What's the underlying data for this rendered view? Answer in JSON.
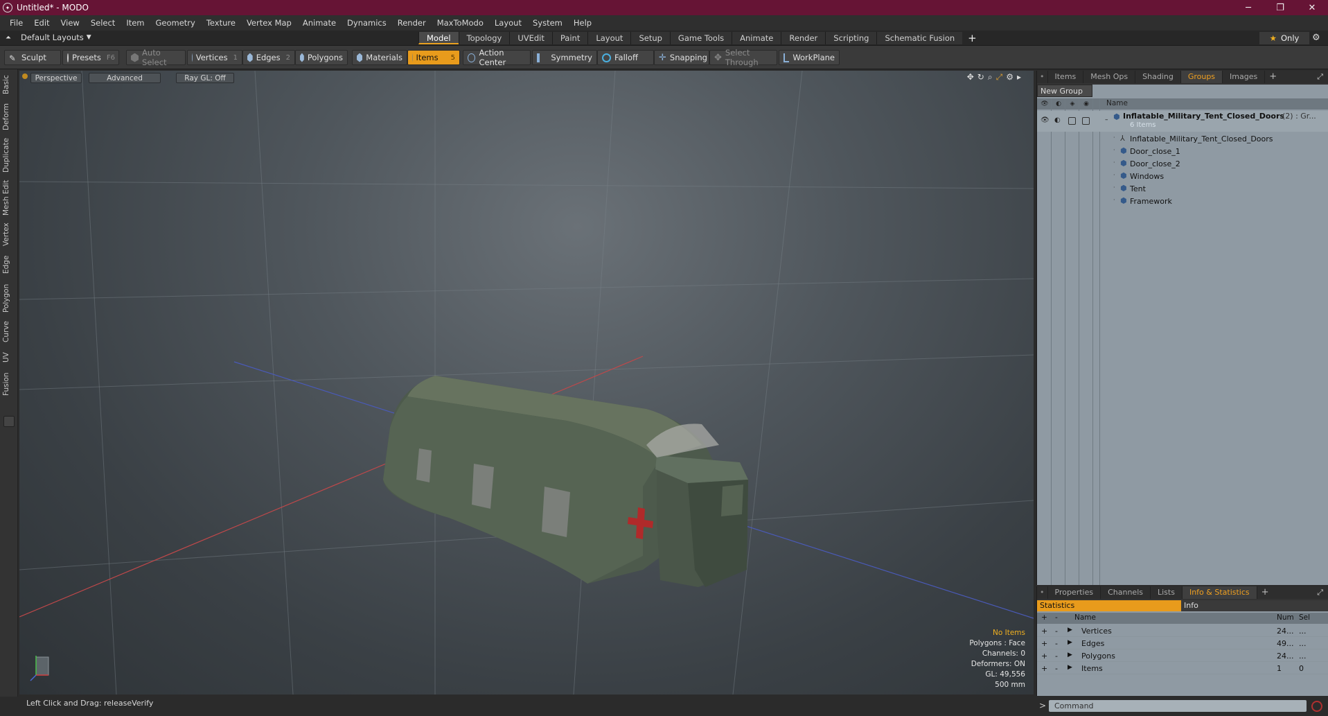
{
  "window": {
    "title": "Untitled* - MODO",
    "minimize": "─",
    "maximize": "❐",
    "close": "✕"
  },
  "menu": [
    "File",
    "Edit",
    "View",
    "Select",
    "Item",
    "Geometry",
    "Texture",
    "Vertex Map",
    "Animate",
    "Dynamics",
    "Render",
    "MaxToModo",
    "Layout",
    "System",
    "Help"
  ],
  "layout": {
    "dropdown": "Default Layouts",
    "tabs": [
      "Model",
      "Topology",
      "UVEdit",
      "Paint",
      "Layout",
      "Setup",
      "Game Tools",
      "Animate",
      "Render",
      "Scripting",
      "Schematic Fusion"
    ],
    "active_tab": "Model",
    "add": "+",
    "only": "Only"
  },
  "toolbar": {
    "sculpt": "Sculpt",
    "presets": "Presets",
    "presets_key": "F6",
    "auto_select": "Auto Select",
    "vertices": "Vertices",
    "vertices_key": "1",
    "edges": "Edges",
    "edges_key": "2",
    "polygons": "Polygons",
    "materials": "Materials",
    "items": "Items",
    "items_key": "5",
    "action_center": "Action Center",
    "symmetry": "Symmetry",
    "falloff": "Falloff",
    "snapping": "Snapping",
    "select_through": "Select Through",
    "workplane": "WorkPlane"
  },
  "left_tabs": [
    "Basic",
    "Deform",
    "Duplicate",
    "Mesh Edit",
    "Vertex",
    "Edge",
    "Polygon",
    "Curve",
    "UV",
    "Fusion"
  ],
  "viewport": {
    "view": "Perspective",
    "shading": "Advanced",
    "raygl": "Ray GL: Off",
    "stats": {
      "selection": "No Items",
      "polygons": "Polygons : Face",
      "channels": "Channels: 0",
      "deformers": "Deformers: ON",
      "gl": "GL: 49,556",
      "scale": "500 mm"
    }
  },
  "status": {
    "text": "Left Click and Drag:  releaseVerify"
  },
  "groups_panel": {
    "tabs": [
      "Items",
      "Mesh Ops",
      "Shading",
      "Groups",
      "Images"
    ],
    "active_tab": "Groups",
    "new_group": "New Group",
    "name_col": "Name",
    "group": {
      "name": "Inflatable_Military_Tent_Closed_Doors",
      "suffix": "(2) : Gr...",
      "count": "6 Items"
    },
    "children": [
      {
        "name": "Inflatable_Military_Tent_Closed_Doors",
        "icon": "locator-icon"
      },
      {
        "name": "Door_close_1",
        "icon": "mesh-icon"
      },
      {
        "name": "Door_close_2",
        "icon": "mesh-icon"
      },
      {
        "name": "Windows",
        "icon": "mesh-icon"
      },
      {
        "name": "Tent",
        "icon": "mesh-icon"
      },
      {
        "name": "Framework",
        "icon": "mesh-icon"
      }
    ]
  },
  "info_panel": {
    "tabs": [
      "Properties",
      "Channels",
      "Lists",
      "Info & Statistics"
    ],
    "active_tab": "Info & Statistics",
    "subtabs": [
      "Statistics",
      "Info"
    ],
    "columns": {
      "add": "+",
      "remove": "-",
      "name": "Name",
      "num": "Num",
      "sel": "Sel"
    },
    "rows": [
      {
        "name": "Vertices",
        "num": "24...",
        "sel": "..."
      },
      {
        "name": "Edges",
        "num": "49...",
        "sel": "..."
      },
      {
        "name": "Polygons",
        "num": "24...",
        "sel": "..."
      },
      {
        "name": "Items",
        "num": "1",
        "sel": "0"
      }
    ]
  },
  "command": {
    "prompt": ">",
    "placeholder": "Command"
  },
  "colors": {
    "accent": "#e89b1c",
    "titlebar": "#661435"
  }
}
